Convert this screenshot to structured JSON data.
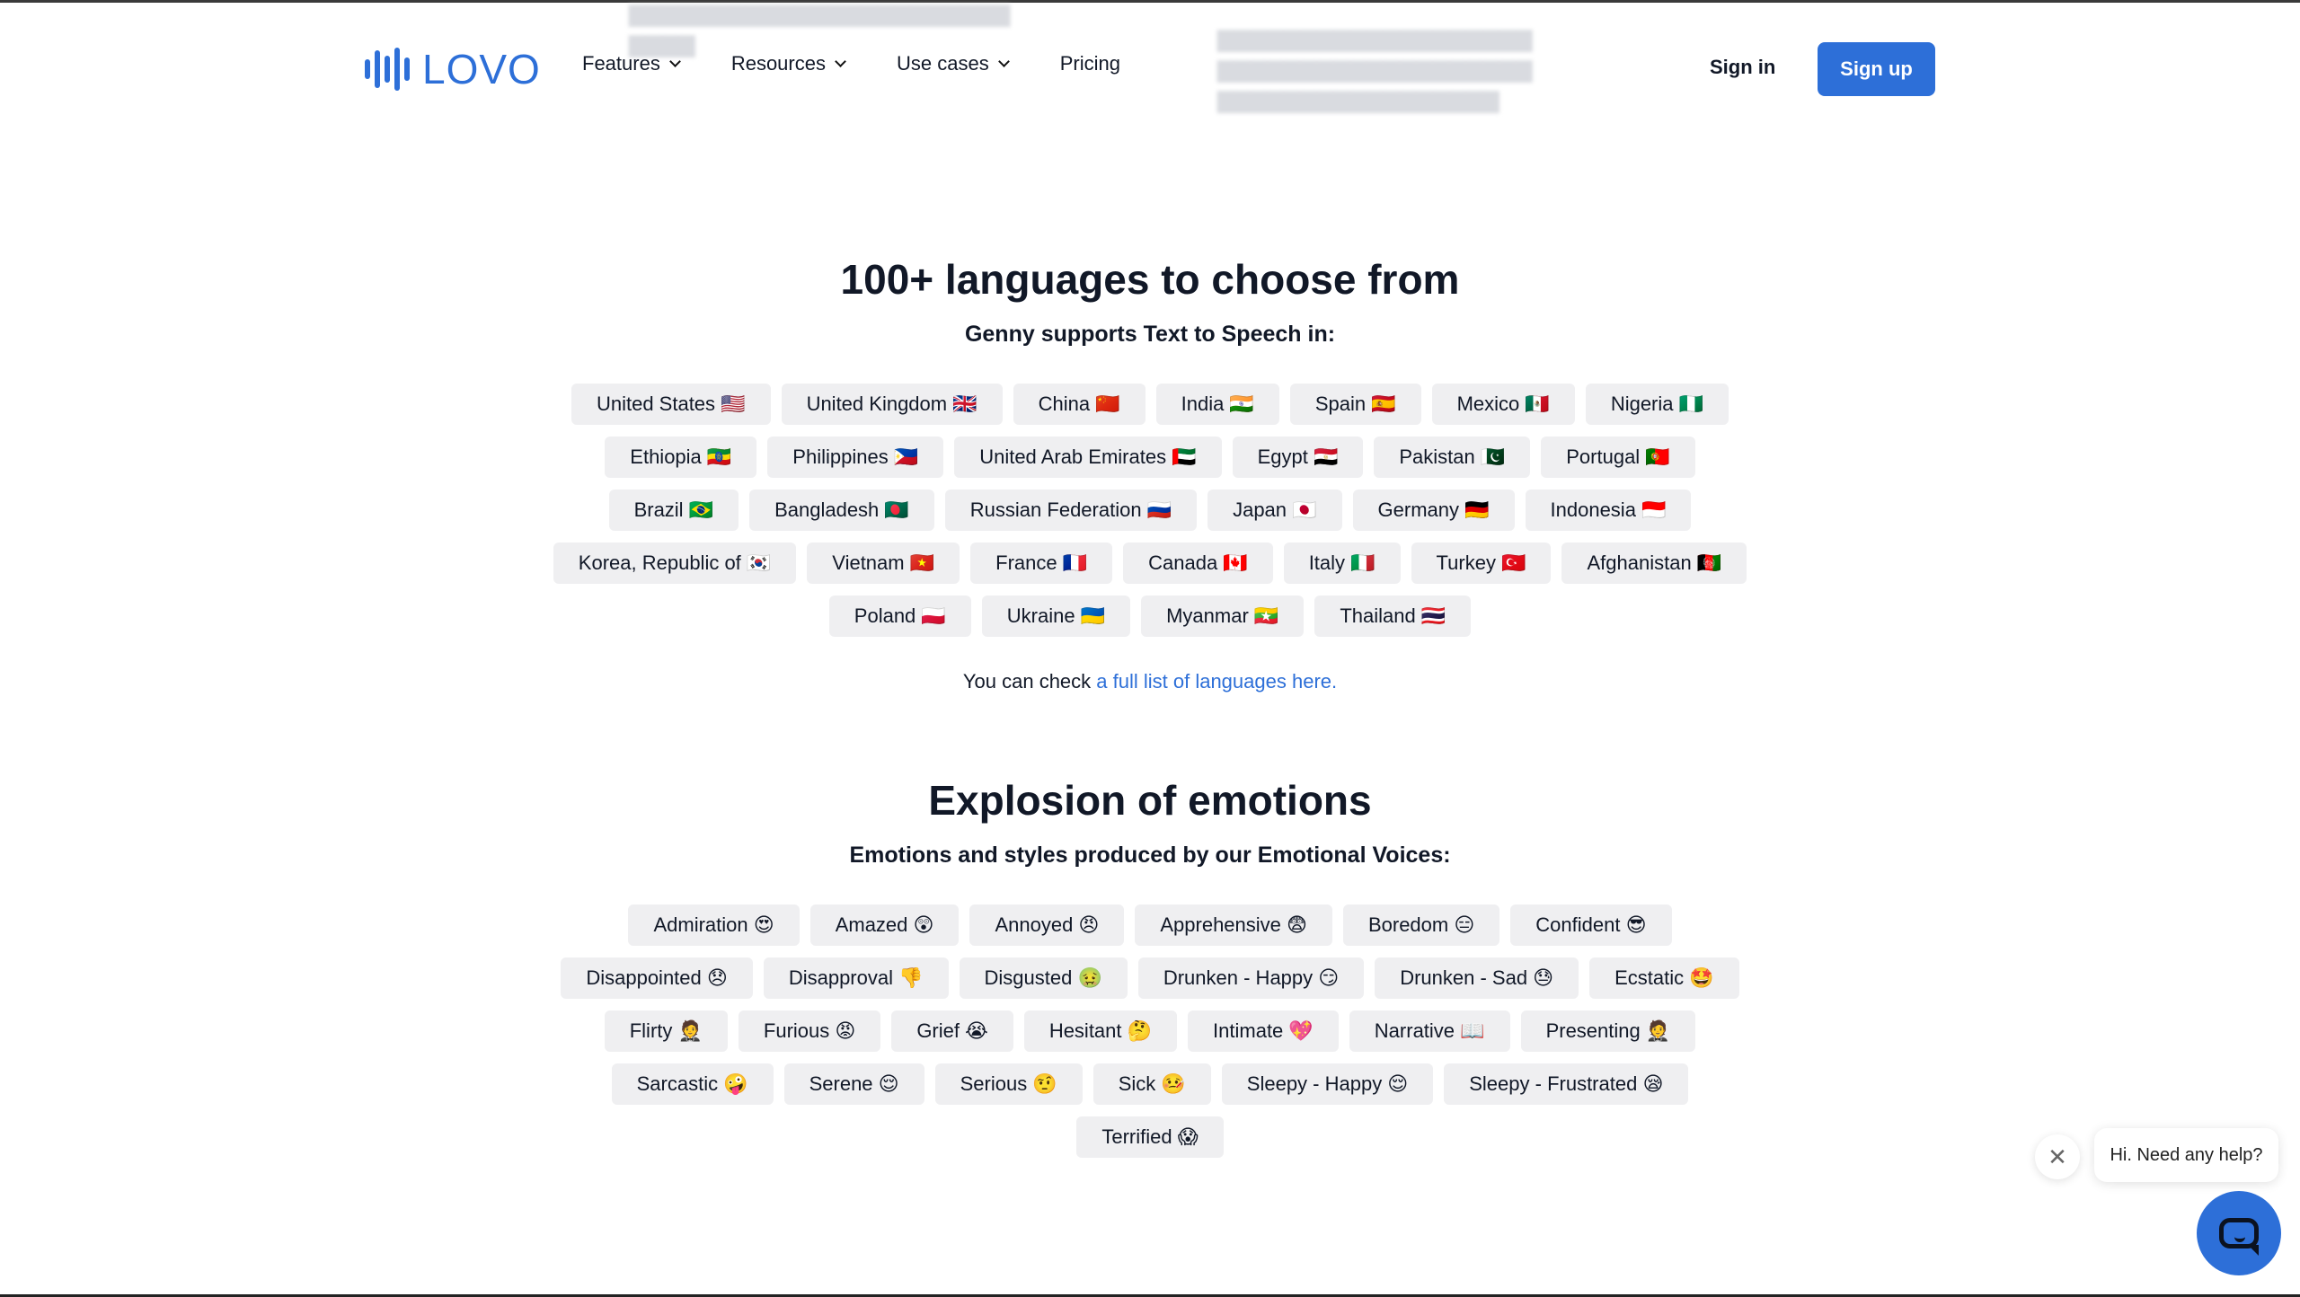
{
  "header": {
    "logo_text": "LOVO",
    "nav": [
      {
        "label": "Features",
        "has_dropdown": true
      },
      {
        "label": "Resources",
        "has_dropdown": true
      },
      {
        "label": "Use cases",
        "has_dropdown": true
      },
      {
        "label": "Pricing",
        "has_dropdown": false
      }
    ],
    "sign_in": "Sign in",
    "sign_up": "Sign up"
  },
  "languages": {
    "title": "100+ languages to choose from",
    "subtitle": "Genny supports Text to Speech in:",
    "items": [
      "United States 🇺🇸",
      "United Kingdom 🇬🇧",
      "China 🇨🇳",
      "India 🇮🇳",
      "Spain 🇪🇸",
      "Mexico 🇲🇽",
      "Nigeria 🇳🇬",
      "Ethiopia 🇪🇹",
      "Philippines 🇵🇭",
      "United Arab Emirates 🇦🇪",
      "Egypt 🇪🇬",
      "Pakistan 🇵🇰",
      "Portugal 🇵🇹",
      "Brazil 🇧🇷",
      "Bangladesh 🇧🇩",
      "Russian Federation 🇷🇺",
      "Japan 🇯🇵",
      "Germany 🇩🇪",
      "Indonesia 🇮🇩",
      "Korea, Republic of 🇰🇷",
      "Vietnam 🇻🇳",
      "France 🇫🇷",
      "Canada 🇨🇦",
      "Italy 🇮🇹",
      "Turkey 🇹🇷",
      "Afghanistan 🇦🇫",
      "Poland 🇵🇱",
      "Ukraine 🇺🇦",
      "Myanmar 🇲🇲",
      "Thailand 🇹🇭"
    ],
    "check_prefix": "You can check ",
    "check_link": "a full list of languages here."
  },
  "emotions": {
    "title": "Explosion of emotions",
    "subtitle": "Emotions and styles produced by our Emotional Voices:",
    "items": [
      "Admiration 😍",
      "Amazed 😲",
      "Annoyed 😠",
      "Apprehensive 😨",
      "Boredom 😑",
      "Confident 😎",
      "Disappointed 😞",
      "Disapproval 👎",
      "Disgusted 🤢",
      "Drunken - Happy 😏",
      "Drunken - Sad 😓",
      "Ecstatic 🤩",
      "Flirty 🤵",
      "Furious 😡",
      "Grief 😭",
      "Hesitant 🤔",
      "Intimate 💖",
      "Narrative 📖",
      "Presenting 🤵",
      "Sarcastic 🤪",
      "Serene 😌",
      "Serious 🤨",
      "Sick 🤒",
      "Sleepy - Happy 😌",
      "Sleepy - Frustrated 😪",
      "Terrified 😱"
    ]
  },
  "chat": {
    "help_text": "Hi. Need any help?",
    "close_glyph": "✕"
  },
  "colors": {
    "accent": "#2d6fd8",
    "chip_bg": "#efeff1"
  }
}
